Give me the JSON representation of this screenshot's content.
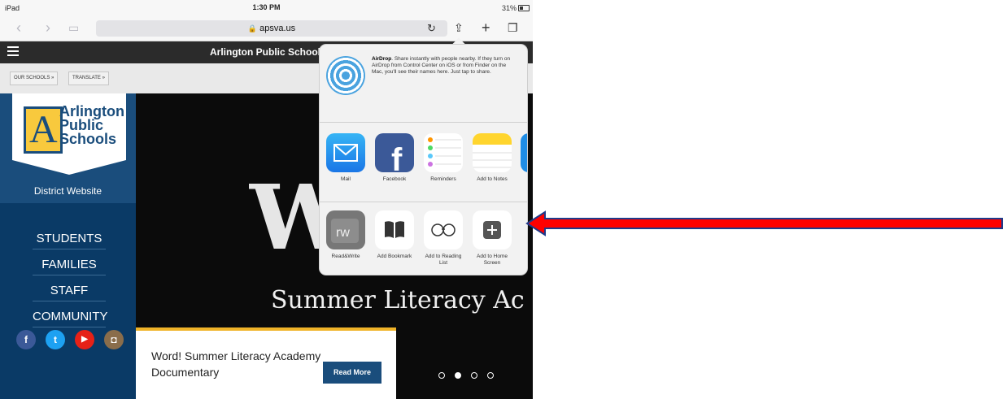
{
  "status": {
    "device": "iPad",
    "time": "1:30 PM",
    "battery": "31%"
  },
  "browser": {
    "url": "apsva.us"
  },
  "site": {
    "title": "Arlington Public Schools",
    "breadcrumbs": [
      "OUR SCHOOLS",
      "TRANSLATE"
    ],
    "logo": {
      "line1": "Arlington",
      "line2": "Public",
      "line3": "Schools",
      "letter": "A"
    },
    "district_label": "District Website",
    "nav": [
      "STUDENTS",
      "FAMILIES",
      "STAFF",
      "COMMUNITY"
    ],
    "social": [
      {
        "icon": "facebook-icon",
        "glyph": "f",
        "color": "#3b5998"
      },
      {
        "icon": "twitter-icon",
        "glyph": "t",
        "color": "#1da1f2"
      },
      {
        "icon": "youtube-icon",
        "glyph": "▶",
        "color": "#e62117"
      },
      {
        "icon": "instagram-icon",
        "glyph": "◘",
        "color": "#8a6d4b"
      }
    ]
  },
  "hero": {
    "big_letter": "W",
    "subtitle": "Summer Literacy Ac",
    "card_title": "Word! Summer Literacy Academy Documentary",
    "read_more": "Read More",
    "slides": 4,
    "active_slide": 2
  },
  "share_sheet": {
    "airdrop": {
      "title": "AirDrop",
      "text": ". Share instantly with people nearby. If they turn on AirDrop from Control Center on iOS or from Finder on the Mac, you'll see their names here. Just tap to share."
    },
    "apps": [
      {
        "label": "Mail",
        "icon": "mail-icon"
      },
      {
        "label": "Facebook",
        "icon": "facebook-app-icon"
      },
      {
        "label": "Reminders",
        "icon": "reminders-icon"
      },
      {
        "label": "Add to Notes",
        "icon": "notes-icon"
      }
    ],
    "actions": [
      {
        "label": "Read&Write",
        "icon": "readwrite-icon"
      },
      {
        "label": "Add Bookmark",
        "icon": "book-icon"
      },
      {
        "label": "Add to Reading List",
        "icon": "glasses-icon"
      },
      {
        "label": "Add to Home Screen",
        "icon": "plus-icon"
      }
    ]
  },
  "annotation": {
    "color": "#ff0000",
    "border": "#1f3a8a"
  }
}
